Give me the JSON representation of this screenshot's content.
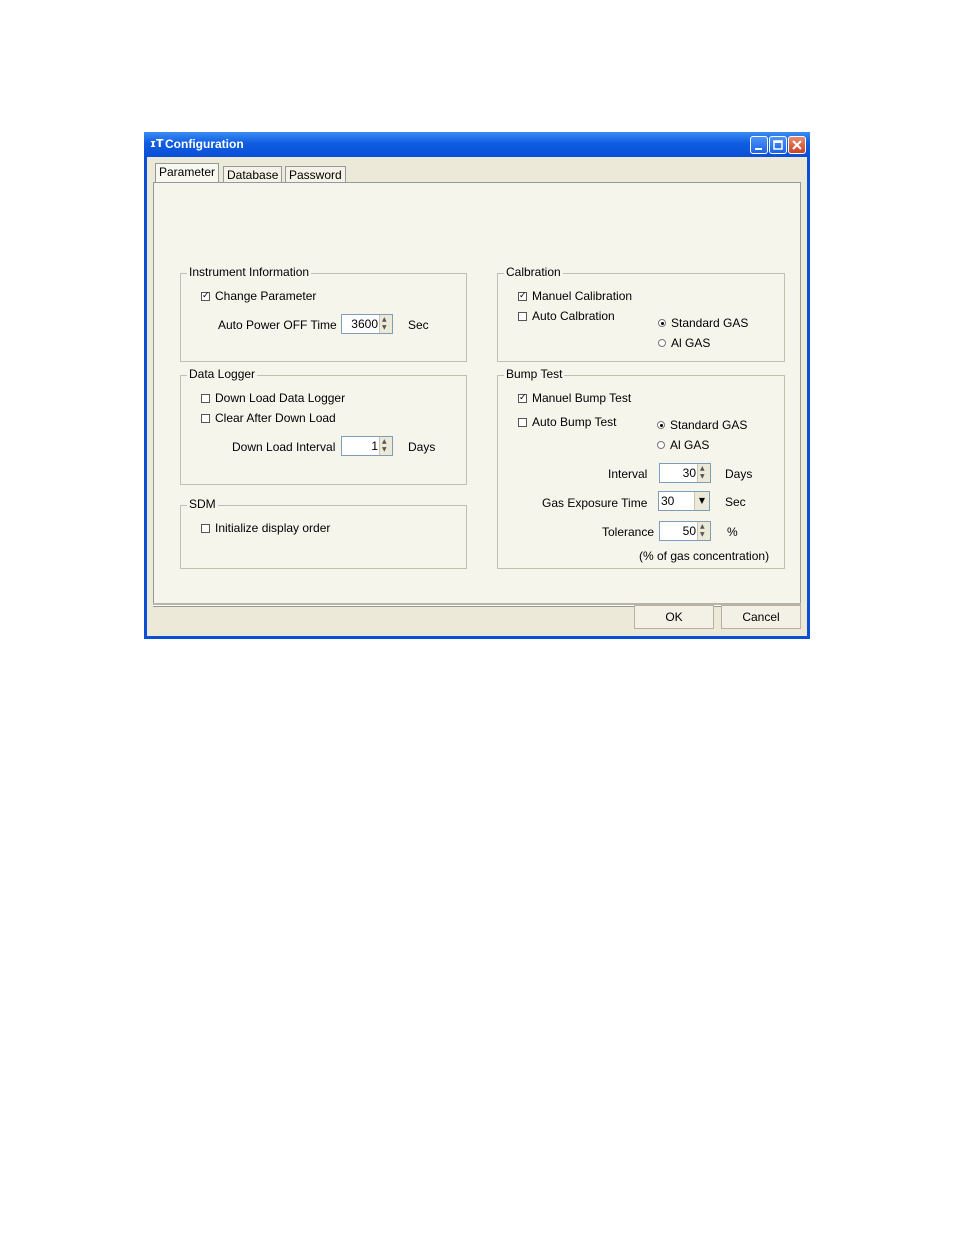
{
  "window": {
    "title": "Configuration",
    "icon": "gas-detector-icon"
  },
  "tabs": [
    {
      "label": "Parameter",
      "active": true
    },
    {
      "label": "Database",
      "active": false
    },
    {
      "label": "Password",
      "active": false
    }
  ],
  "instrument": {
    "legend": "Instrument Information",
    "change_parameter": {
      "label": "Change Parameter",
      "checked": true
    },
    "auto_power_label": "Auto Power OFF Time",
    "auto_power_value": "3600",
    "auto_power_unit": "Sec"
  },
  "data_logger": {
    "legend": "Data Logger",
    "download": {
      "label": "Down Load Data Logger",
      "checked": false
    },
    "clear": {
      "label": "Clear After Down Load",
      "checked": false
    },
    "interval_label": "Down Load Interval",
    "interval_value": "1",
    "interval_unit": "Days"
  },
  "sdm": {
    "legend": "SDM",
    "init": {
      "label": "Initialize display order",
      "checked": false
    }
  },
  "calibration": {
    "legend": "Calbration",
    "manual": {
      "label": "Manuel Calibration",
      "checked": true
    },
    "auto": {
      "label": "Auto Calbration",
      "checked": false
    },
    "standard_gas": "Standard GAS",
    "all_gas": "Al GAS",
    "selected": "standard"
  },
  "bump": {
    "legend": "Bump Test",
    "manual": {
      "label": "Manuel Bump Test",
      "checked": true
    },
    "auto": {
      "label": "Auto Bump Test",
      "checked": false
    },
    "standard_gas": "Standard GAS",
    "all_gas": "Al GAS",
    "selected": "standard",
    "interval_label": "Interval",
    "interval_value": "30",
    "interval_unit": "Days",
    "exposure_label": "Gas Exposure Time",
    "exposure_value": "30",
    "exposure_unit": "Sec",
    "tolerance_label": "Tolerance",
    "tolerance_value": "50",
    "tolerance_unit": "%",
    "note": "(% of gas concentration)"
  },
  "buttons": {
    "ok": "OK",
    "cancel": "Cancel"
  },
  "colors": {
    "titlebar": "#0a4fd6",
    "dialog_bg": "#ece9d8"
  }
}
